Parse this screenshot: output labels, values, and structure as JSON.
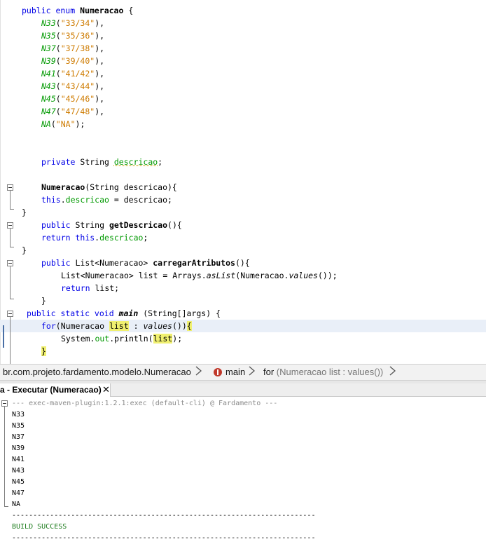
{
  "editor": {
    "lines": [
      {
        "indent": 4,
        "parts": [
          {
            "t": "public enum ",
            "c": "kw"
          },
          {
            "t": "Numeracao",
            "c": "bold"
          },
          {
            "t": " {",
            "c": ""
          }
        ]
      },
      {
        "indent": 8,
        "parts": [
          {
            "t": "N33",
            "c": "enumc"
          },
          {
            "t": "(",
            "c": ""
          },
          {
            "t": "\"33/34\"",
            "c": "str"
          },
          {
            "t": "),",
            "c": ""
          }
        ]
      },
      {
        "indent": 8,
        "parts": [
          {
            "t": "N35",
            "c": "enumc"
          },
          {
            "t": "(",
            "c": ""
          },
          {
            "t": "\"35/36\"",
            "c": "str"
          },
          {
            "t": "),",
            "c": ""
          }
        ]
      },
      {
        "indent": 8,
        "parts": [
          {
            "t": "N37",
            "c": "enumc"
          },
          {
            "t": "(",
            "c": ""
          },
          {
            "t": "\"37/38\"",
            "c": "str"
          },
          {
            "t": "),",
            "c": ""
          }
        ]
      },
      {
        "indent": 8,
        "parts": [
          {
            "t": "N39",
            "c": "enumc"
          },
          {
            "t": "(",
            "c": ""
          },
          {
            "t": "\"39/40\"",
            "c": "str"
          },
          {
            "t": "),",
            "c": ""
          }
        ]
      },
      {
        "indent": 8,
        "parts": [
          {
            "t": "N41",
            "c": "enumc"
          },
          {
            "t": "(",
            "c": ""
          },
          {
            "t": "\"41/42\"",
            "c": "str"
          },
          {
            "t": "),",
            "c": ""
          }
        ]
      },
      {
        "indent": 8,
        "parts": [
          {
            "t": "N43",
            "c": "enumc"
          },
          {
            "t": "(",
            "c": ""
          },
          {
            "t": "\"43/44\"",
            "c": "str"
          },
          {
            "t": "),",
            "c": ""
          }
        ]
      },
      {
        "indent": 8,
        "parts": [
          {
            "t": "N45",
            "c": "enumc"
          },
          {
            "t": "(",
            "c": ""
          },
          {
            "t": "\"45/46\"",
            "c": "str"
          },
          {
            "t": "),",
            "c": ""
          }
        ]
      },
      {
        "indent": 8,
        "parts": [
          {
            "t": "N47",
            "c": "enumc"
          },
          {
            "t": "(",
            "c": ""
          },
          {
            "t": "\"47/48\"",
            "c": "str"
          },
          {
            "t": "),",
            "c": ""
          }
        ]
      },
      {
        "indent": 8,
        "parts": [
          {
            "t": "NA",
            "c": "enumc"
          },
          {
            "t": "(",
            "c": ""
          },
          {
            "t": "\"NA\"",
            "c": "str"
          },
          {
            "t": ");",
            "c": ""
          }
        ]
      },
      {
        "indent": 0,
        "parts": []
      },
      {
        "indent": 0,
        "parts": []
      },
      {
        "indent": 8,
        "parts": [
          {
            "t": "private ",
            "c": "kw"
          },
          {
            "t": "String ",
            "c": ""
          },
          {
            "t": "descricao",
            "c": "fld-u"
          },
          {
            "t": ";",
            "c": ""
          }
        ]
      },
      {
        "indent": 0,
        "parts": []
      },
      {
        "indent": 8,
        "parts": [
          {
            "t": "Numeracao",
            "c": "bold"
          },
          {
            "t": "(String descricao){",
            "c": ""
          }
        ]
      },
      {
        "indent": 8,
        "parts": [
          {
            "t": "this",
            "c": "kw"
          },
          {
            "t": ".",
            "c": ""
          },
          {
            "t": "descricao",
            "c": "fld"
          },
          {
            "t": " = descricao;",
            "c": ""
          }
        ]
      },
      {
        "indent": 4,
        "parts": [
          {
            "t": "}",
            "c": ""
          }
        ]
      },
      {
        "indent": 8,
        "parts": [
          {
            "t": "public ",
            "c": "kw"
          },
          {
            "t": "String ",
            "c": ""
          },
          {
            "t": "getDescricao",
            "c": "bold"
          },
          {
            "t": "(){",
            "c": ""
          }
        ]
      },
      {
        "indent": 8,
        "parts": [
          {
            "t": "return ",
            "c": "kw"
          },
          {
            "t": "this",
            "c": "kw"
          },
          {
            "t": ".",
            "c": ""
          },
          {
            "t": "descricao",
            "c": "fld"
          },
          {
            "t": ";",
            "c": ""
          }
        ]
      },
      {
        "indent": 4,
        "parts": [
          {
            "t": "}",
            "c": ""
          }
        ]
      },
      {
        "indent": 8,
        "parts": [
          {
            "t": "public ",
            "c": "kw"
          },
          {
            "t": "List<Numeracao> ",
            "c": ""
          },
          {
            "t": "carregarAtributos",
            "c": "bold"
          },
          {
            "t": "(){",
            "c": ""
          }
        ]
      },
      {
        "indent": 12,
        "parts": [
          {
            "t": "List<Numeracao> list = Arrays.",
            "c": ""
          },
          {
            "t": "asList",
            "c": "ital"
          },
          {
            "t": "(Numeracao.",
            "c": ""
          },
          {
            "t": "values",
            "c": "ital"
          },
          {
            "t": "());",
            "c": ""
          }
        ]
      },
      {
        "indent": 12,
        "parts": [
          {
            "t": "return ",
            "c": "kw"
          },
          {
            "t": "list;",
            "c": ""
          }
        ]
      },
      {
        "indent": 8,
        "parts": [
          {
            "t": "}",
            "c": ""
          }
        ]
      },
      {
        "indent": 5,
        "parts": [
          {
            "t": "public static void ",
            "c": "kw"
          },
          {
            "t": "main",
            "c": "boldit"
          },
          {
            "t": " (String[]args) {",
            "c": ""
          }
        ]
      },
      {
        "indent": 8,
        "parts": [
          {
            "t": "for",
            "c": "kw"
          },
          {
            "t": "(Numeracao ",
            "c": ""
          },
          {
            "t": "list",
            "c": "hl"
          },
          {
            "t": " : ",
            "c": ""
          },
          {
            "t": "values",
            "c": "ital"
          },
          {
            "t": "())",
            "c": ""
          },
          {
            "t": "{",
            "c": "hl"
          }
        ]
      },
      {
        "indent": 12,
        "parts": [
          {
            "t": "System.",
            "c": ""
          },
          {
            "t": "out",
            "c": "fld"
          },
          {
            "t": ".println(",
            "c": ""
          },
          {
            "t": "list",
            "c": "hl"
          },
          {
            "t": ");",
            "c": ""
          }
        ]
      },
      {
        "indent": 8,
        "parts": [
          {
            "t": "}",
            "c": "hl"
          }
        ]
      }
    ]
  },
  "breadcrumb": {
    "class_path": "br.com.projeto.fardamento.modelo.Numeracao",
    "method": "main",
    "loop_keyword": "for",
    "loop_detail": "(Numeracao list : values())"
  },
  "output_panel": {
    "tab_label": "a - Executar (Numeracao)",
    "close_glyph": "✕",
    "header_line": "--- exec-maven-plugin:1.2.1:exec (default-cli) @ Fardamento ---",
    "lines": [
      "N33",
      "N35",
      "N37",
      "N39",
      "N41",
      "N43",
      "N45",
      "N47",
      "NA"
    ],
    "rule": "------------------------------------------------------------------------",
    "status": "BUILD SUCCESS",
    "rule2": "------------------------------------------------------------------------"
  },
  "colors": {
    "keyword": "#0000e6",
    "enum_constant": "#009900",
    "string": "#ce7b00",
    "highlight": "#f0f070",
    "current_line": "#e9eff8",
    "build_success": "#1e7d1e"
  }
}
